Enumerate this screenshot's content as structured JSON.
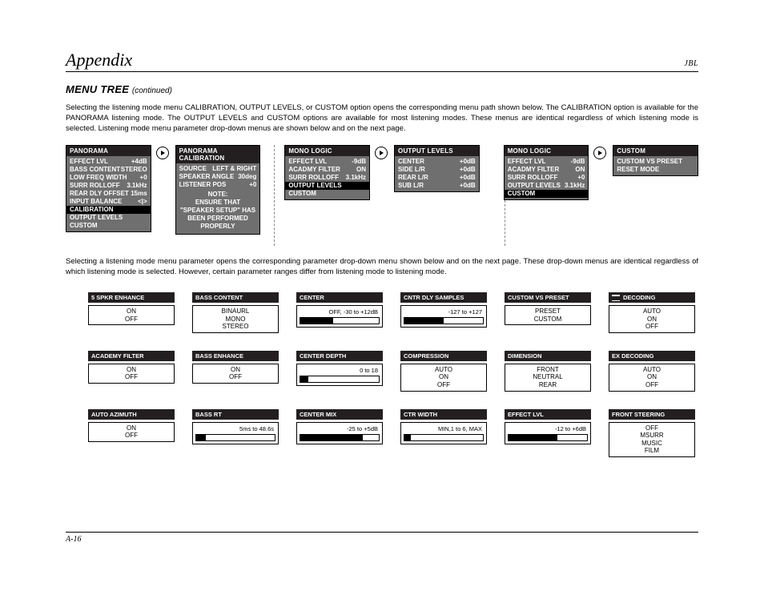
{
  "header": {
    "title": "Appendix",
    "brand": "JBL"
  },
  "subtitle": {
    "bold": "MENU TREE",
    "cont": "(continued)"
  },
  "para1": "Selecting the listening mode menu CALIBRATION, OUTPUT LEVELS, or CUSTOM option opens the corresponding menu path shown below. The CALIBRATION option is available for the PANORAMA listening mode. The OUTPUT LEVELS and CUSTOM options are available for most listening modes. These menus are identical regardless of which listening mode is selected. Listening mode menu parameter drop-down menus are shown below and on the next page.",
  "para2": "Selecting a listening mode menu parameter opens the corresponding parameter drop-down menu shown below and on the next page. These drop-down menus are identical regardless of which listening mode is selected. However, certain parameter ranges differ from listening mode to listening mode.",
  "footer": "A-16",
  "tree": [
    {
      "title": "PANORAMA",
      "arrow": true,
      "rows": [
        [
          "EFFECT LVL",
          "+4dB"
        ],
        [
          "BASS CONTENT",
          "STEREO"
        ],
        [
          "LOW FREQ WIDTH",
          "+0"
        ],
        [
          "SURR ROLLOFF",
          "3.1kHz"
        ],
        [
          "REAR DLY OFFSET",
          "15ms"
        ],
        [
          "INPUT BALANCE",
          "<|>"
        ]
      ],
      "highlight": "CALIBRATION",
      "after": [
        "OUTPUT LEVELS",
        "CUSTOM"
      ]
    },
    {
      "title": "PANORAMA CALIBRATION",
      "rows": [
        [
          "SOURCE",
          "LEFT & RIGHT"
        ],
        [
          "SPEAKER ANGLE",
          "30deg"
        ],
        [
          "LISTENER POS",
          "+0"
        ]
      ],
      "note": [
        "NOTE:",
        "ENSURE THAT",
        "\"SPEAKER SETUP\" HAS",
        "BEEN PERFORMED",
        "PROPERLY"
      ]
    },
    {
      "title": "MONO LOGIC",
      "arrow": true,
      "rows": [
        [
          "EFFECT LVL",
          "-9dB"
        ],
        [
          "ACADMY FILTER",
          "ON"
        ],
        [
          "SURR ROLLOFF",
          "3.1kHz"
        ]
      ],
      "highlight": "OUTPUT LEVELS",
      "after": [
        "CUSTOM"
      ]
    },
    {
      "title": "OUTPUT LEVELS",
      "rows": [
        [
          "CENTER",
          "+0dB"
        ],
        [
          "SIDE L/R",
          "+0dB"
        ],
        [
          "REAR L/R",
          "+0dB"
        ],
        [
          "SUB L/R",
          "+0dB"
        ]
      ]
    },
    {
      "title": "MONO LOGIC",
      "arrow": true,
      "rows": [
        [
          "EFFECT LVL",
          "-9dB"
        ],
        [
          "ACADMY FILTER",
          "ON"
        ],
        [
          "SURR ROLLOFF",
          "+0"
        ],
        [
          "OUTPUT LEVELS",
          "3.1kHz"
        ]
      ],
      "highlight": "CUSTOM",
      "after": []
    },
    {
      "title": "CUSTOM",
      "rows": [
        [
          "CUSTOM VS PRESET",
          ""
        ],
        [
          "RESET MODE",
          ""
        ]
      ]
    }
  ],
  "params": [
    [
      {
        "t": "5 SPKR ENHANCE",
        "type": "list",
        "opts": [
          "ON",
          "OFF"
        ]
      },
      {
        "t": "BASS CONTENT",
        "type": "list",
        "opts": [
          "BINAURL",
          "MONO",
          "STEREO"
        ]
      },
      {
        "t": "CENTER",
        "type": "slider",
        "label": "OFF, -30 to +12dB",
        "fill": 42
      },
      {
        "t": "CNTR DLY SAMPLES",
        "type": "slider",
        "label": "-127 to +127",
        "fill": 50
      },
      {
        "t": "CUSTOM VS PRESET",
        "type": "list",
        "opts": [
          "PRESET",
          "CUSTOM"
        ]
      },
      {
        "t": "DECODING",
        "logo": true,
        "type": "list",
        "opts": [
          "AUTO",
          "ON",
          "OFF"
        ]
      }
    ],
    [
      {
        "t": "ACADEMY FILTER",
        "type": "list",
        "opts": [
          "ON",
          "OFF"
        ]
      },
      {
        "t": "BASS ENHANCE",
        "type": "list",
        "opts": [
          "ON",
          "OFF"
        ]
      },
      {
        "t": "CENTER DEPTH",
        "type": "slider",
        "label": "0 to 18",
        "fill": 10
      },
      {
        "t": "COMPRESSION",
        "type": "list",
        "opts": [
          "AUTO",
          "ON",
          "OFF"
        ]
      },
      {
        "t": "DIMENSION",
        "type": "list",
        "opts": [
          "FRONT",
          "NEUTRAL",
          "REAR"
        ]
      },
      {
        "t": "EX DECODING",
        "type": "list",
        "opts": [
          "AUTO",
          "ON",
          "OFF"
        ]
      }
    ],
    [
      {
        "t": "AUTO AZIMUTH",
        "type": "list",
        "opts": [
          "ON",
          "OFF"
        ]
      },
      {
        "t": "BASS RT",
        "type": "slider",
        "label": "5ms to 48.6s",
        "fill": 12
      },
      {
        "t": "CENTER MIX",
        "type": "slider",
        "label": "-25 to +5dB",
        "fill": 80
      },
      {
        "t": "CTR WIDTH",
        "type": "slider",
        "label": "MIN,1 to 6, MAX",
        "fill": 8
      },
      {
        "t": "EFFECT LVL",
        "type": "slider",
        "label": "-12 to +6dB",
        "fill": 62
      },
      {
        "t": "FRONT STEERING",
        "type": "list",
        "opts": [
          "OFF",
          "MSURR",
          "MUSIC",
          "FILM"
        ]
      }
    ]
  ]
}
